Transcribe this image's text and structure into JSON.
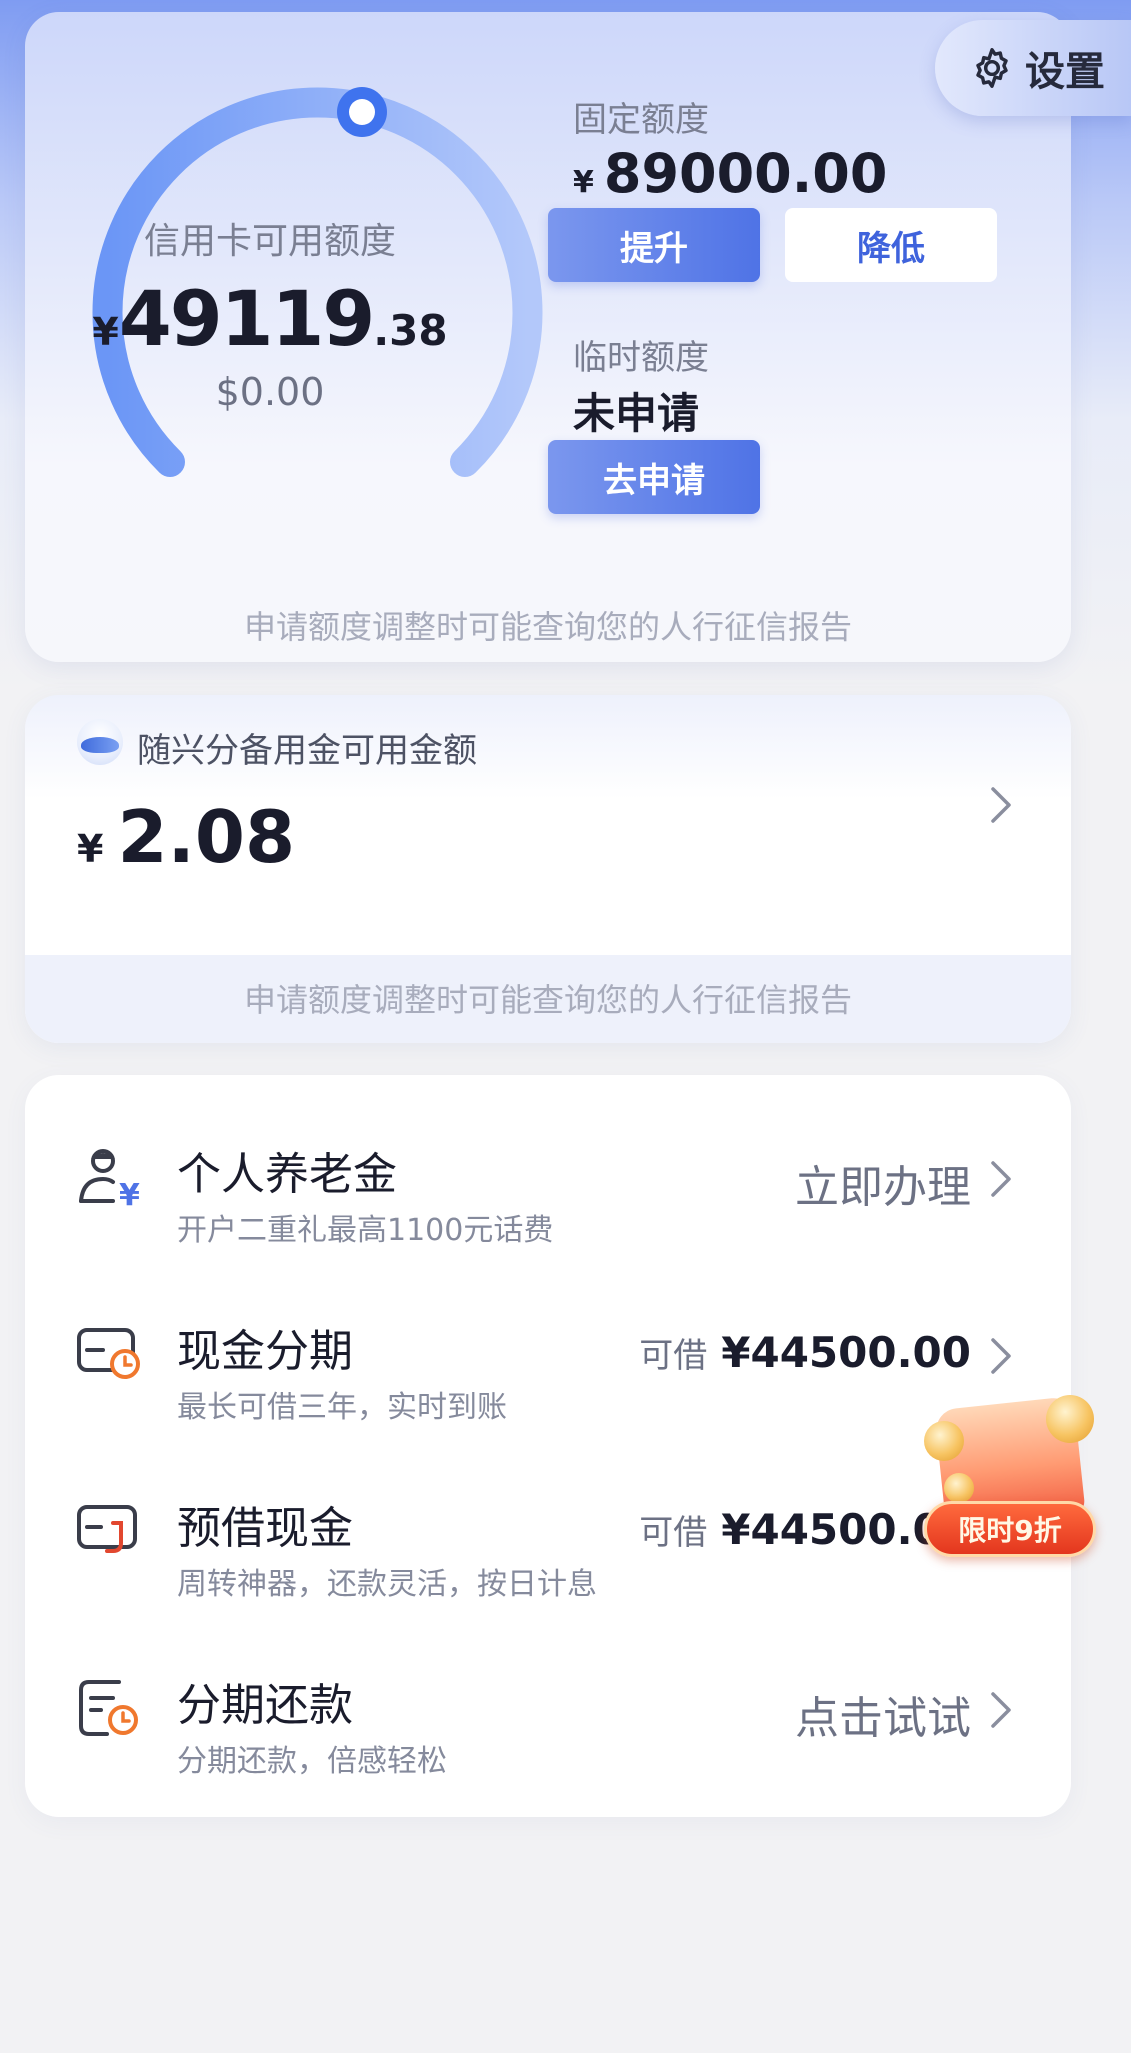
{
  "colors": {
    "accent": "#4f73e6",
    "text_primary": "#1a1c2c",
    "text_secondary": "#7a7f92",
    "promo": "#e3361e"
  },
  "credit_card": {
    "settings_label": "设置",
    "gauge_title": "信用卡可用额度",
    "available_currency": "¥",
    "available_int": "49119",
    "available_dec": ".38",
    "usd_amount": "$0.00",
    "fixed_label": "固定额度",
    "fixed_currency": "¥",
    "fixed_amount": "89000.00",
    "raise_button": "提升",
    "lower_button": "降低",
    "temp_label": "临时额度",
    "temp_status": "未申请",
    "apply_button": "去申请",
    "note": "申请额度调整时可能查询您的人行征信报告"
  },
  "installment_funds": {
    "title": "随兴分备用金可用金额",
    "currency": "¥",
    "amount": "2.08",
    "note": "申请额度调整时可能查询您的人行征信报告"
  },
  "services": [
    {
      "icon": "pension-icon",
      "title": "个人养老金",
      "subtitle": "开户二重礼最高1100元话费",
      "action": "立即办理"
    },
    {
      "icon": "cash-installment-icon",
      "title": "现金分期",
      "subtitle": "最长可借三年，实时到账",
      "prefix": "可借",
      "amount": "¥44500.00"
    },
    {
      "icon": "advance-cash-icon",
      "title": "预借现金",
      "subtitle": "周转神器，还款灵活，按日计息",
      "prefix": "可借",
      "amount": "¥44500.00"
    },
    {
      "icon": "installment-repay-icon",
      "title": "分期还款",
      "subtitle": "分期还款，倍感轻松",
      "action": "点击试试"
    }
  ],
  "promo": {
    "label": "限时9折"
  }
}
